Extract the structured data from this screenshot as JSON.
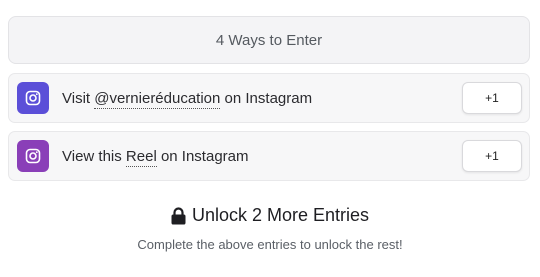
{
  "header": {
    "title": "4 Ways to Enter"
  },
  "entries": [
    {
      "icon": "instagram-icon",
      "icon_color": "#5b4fd8",
      "prefix": "Visit ",
      "link": "@vernieréducation",
      "suffix": " on Instagram",
      "points": "+1"
    },
    {
      "icon": "instagram-icon",
      "icon_color": "#8a3fb8",
      "prefix": "View this ",
      "link": "Reel",
      "suffix": " on Instagram",
      "points": "+1"
    }
  ],
  "unlock": {
    "icon": "lock-icon",
    "title": "Unlock 2 More Entries",
    "subtitle": "Complete the above entries to unlock the rest!"
  }
}
